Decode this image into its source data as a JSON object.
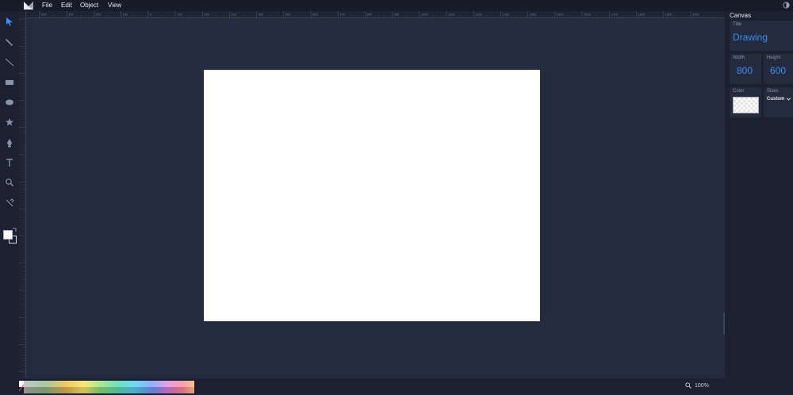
{
  "menu": {
    "items": [
      "File",
      "Edit",
      "Object",
      "View"
    ]
  },
  "tools": [
    {
      "name": "select-icon",
      "active": true
    },
    {
      "name": "pencil-icon"
    },
    {
      "name": "line-icon"
    },
    {
      "name": "rectangle-icon"
    },
    {
      "name": "ellipse-icon"
    },
    {
      "name": "star-icon"
    },
    {
      "name": "pen-icon"
    },
    {
      "name": "text-icon"
    },
    {
      "name": "zoom-icon"
    },
    {
      "name": "eyedropper-icon"
    }
  ],
  "panel": {
    "title": "Canvas",
    "title_field": {
      "label": "Title",
      "value": "Drawing"
    },
    "width_field": {
      "label": "Width",
      "value": "800"
    },
    "height_field": {
      "label": "Height",
      "value": "600"
    },
    "color_field": {
      "label": "Color"
    },
    "sizes_field": {
      "label": "Sizes",
      "value": "Custom"
    }
  },
  "ruler": {
    "top_labels": [
      "400",
      "300",
      "200",
      "100",
      "0",
      "100",
      "200",
      "300",
      "400",
      "500",
      "600",
      "700",
      "800",
      "900",
      "1000",
      "1100",
      "1200",
      "1300",
      "1400",
      "1500",
      "1600",
      "1700",
      "1800",
      "1900",
      "2000"
    ]
  },
  "zoom": {
    "value": "100%"
  },
  "colors": {
    "accent": "#3a8ff7",
    "workspace": "#242b3d",
    "chrome": "#1b2130",
    "canvas": "#ffffff"
  }
}
